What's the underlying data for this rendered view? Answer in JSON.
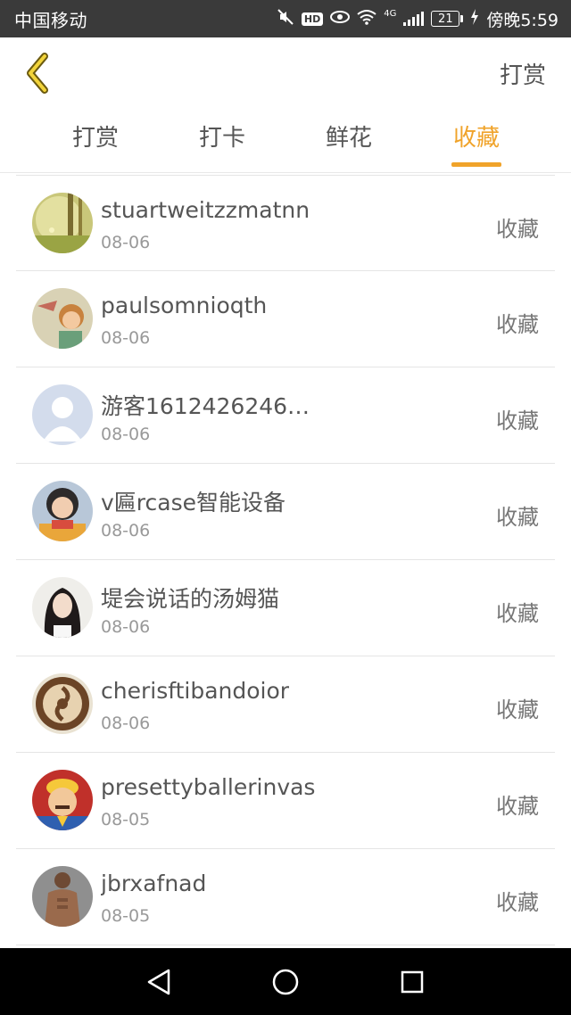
{
  "status_bar": {
    "carrier": "中国移动",
    "network": "4G",
    "battery": "21",
    "time": "傍晚5:59",
    "hd_label": "HD"
  },
  "header": {
    "action_label": "打赏"
  },
  "tabs": [
    {
      "label": "打赏",
      "active": false
    },
    {
      "label": "打卡",
      "active": false
    },
    {
      "label": "鲜花",
      "active": false
    },
    {
      "label": "收藏",
      "active": true
    }
  ],
  "colors": {
    "accent": "#f0a32a",
    "status_bar": "#3a3a3a",
    "text_primary": "#555555",
    "text_secondary": "#999999"
  },
  "items": [
    {
      "name": "stuartweitzzmatnn",
      "date": "08-06",
      "action": "收藏",
      "avatar": "forest-avatar"
    },
    {
      "name": "paulsomnioqth",
      "date": "08-06",
      "action": "收藏",
      "avatar": "cartoon-avatar"
    },
    {
      "name": "游客1612426246…",
      "date": "08-06",
      "action": "收藏",
      "avatar": "default-avatar"
    },
    {
      "name": "v匾rcase智能设备",
      "date": "08-06",
      "action": "收藏",
      "avatar": "girl-avatar"
    },
    {
      "name": "堤会说话的汤姆猫",
      "date": "08-06",
      "action": "收藏",
      "avatar": "woman-avatar"
    },
    {
      "name": "cherisftibandoior",
      "date": "08-06",
      "action": "收藏",
      "avatar": "latte-avatar"
    },
    {
      "name": "presettyballerinvas",
      "date": "08-05",
      "action": "收藏",
      "avatar": "cartoon-man-avatar"
    },
    {
      "name": "jbrxafnad",
      "date": "08-05",
      "action": "收藏",
      "avatar": "athlete-avatar"
    }
  ]
}
